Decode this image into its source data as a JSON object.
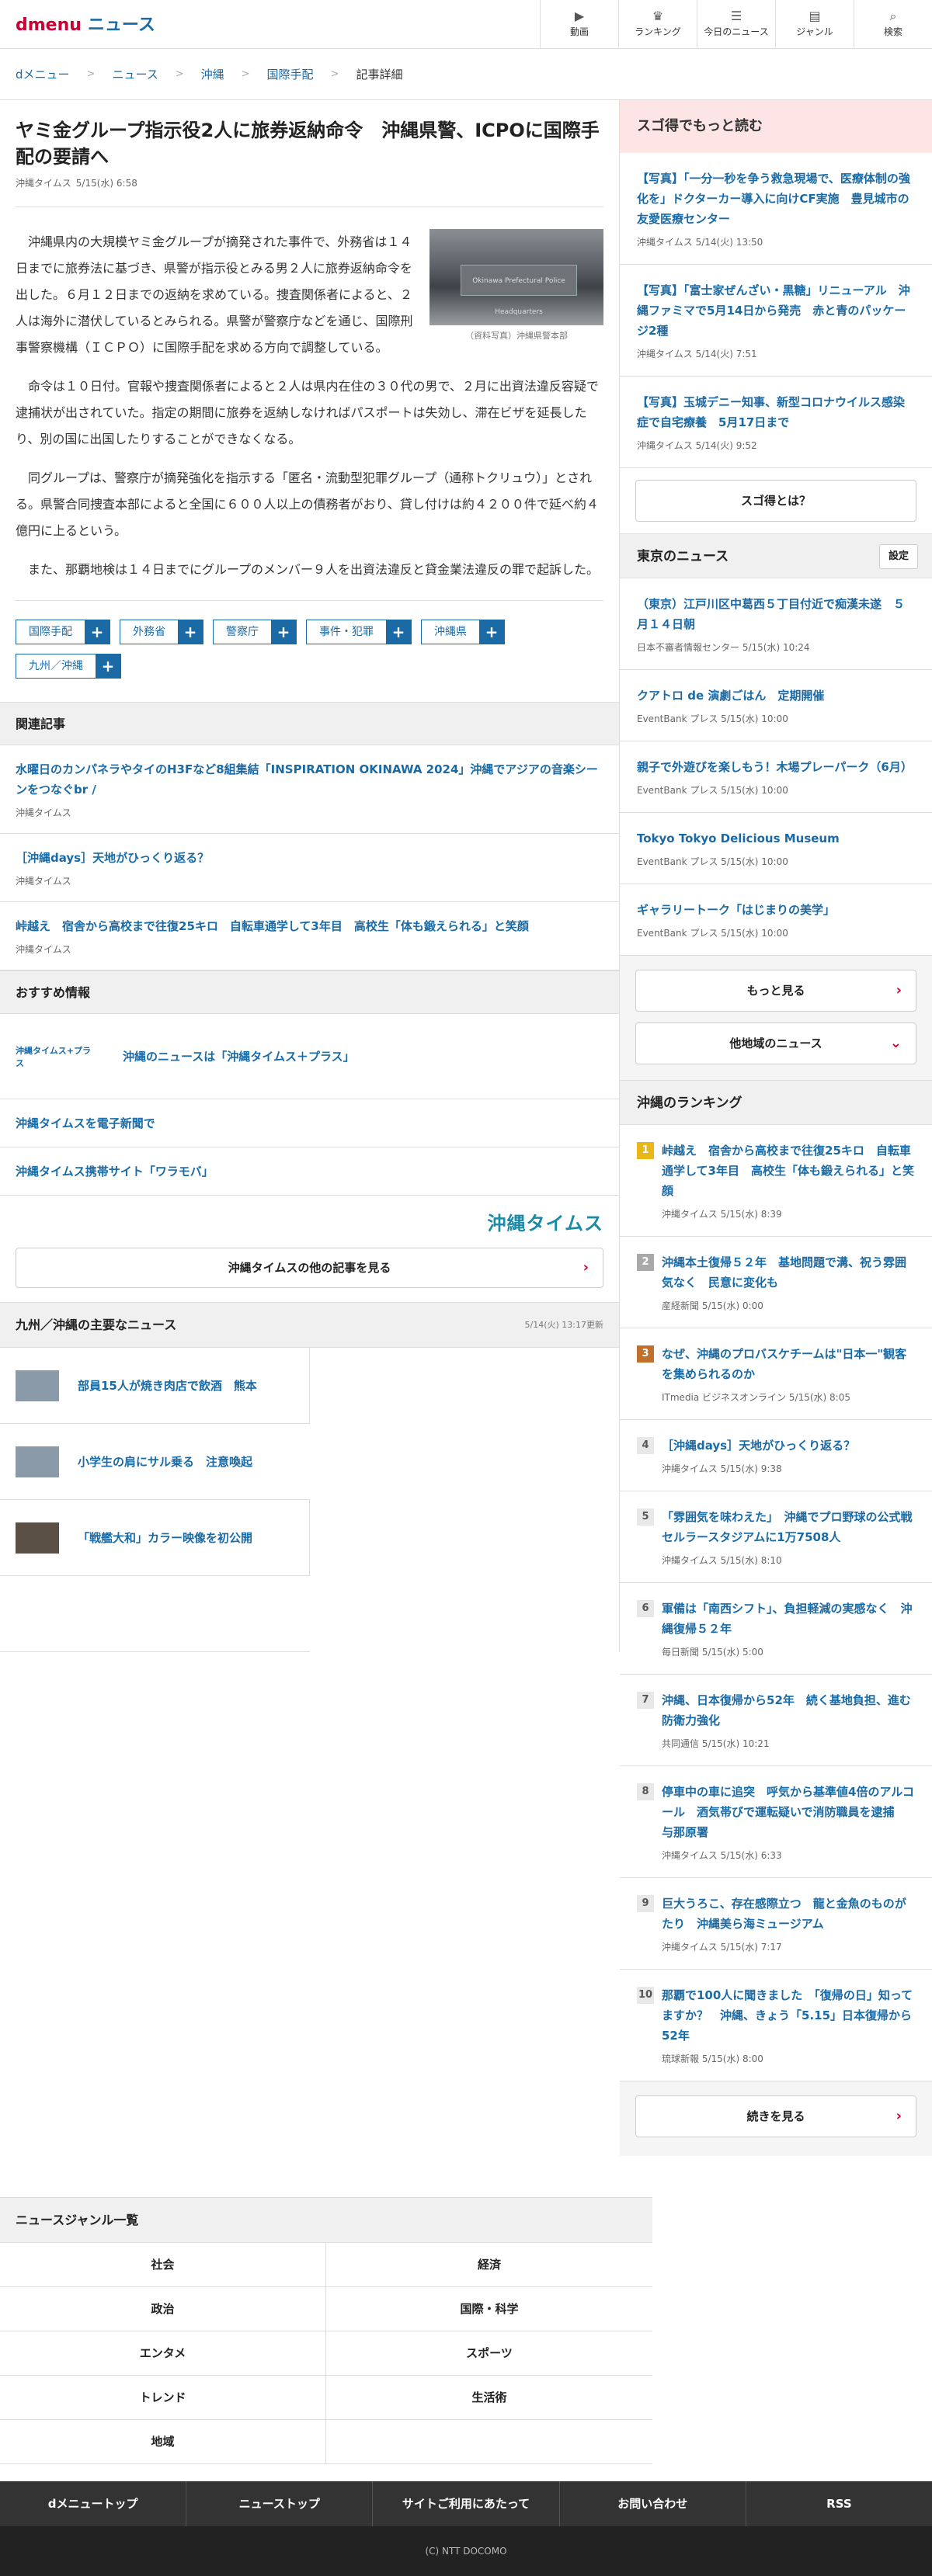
{
  "header": {
    "logo_d": "dmenu",
    "logo_news": "ニュース",
    "nav": [
      {
        "icon": "video-icon",
        "glyph": "▶",
        "label": "動画"
      },
      {
        "icon": "ranking-icon",
        "glyph": "♛",
        "label": "ランキング"
      },
      {
        "icon": "today-icon",
        "glyph": "☰",
        "label": "今日のニュース"
      },
      {
        "icon": "genre-icon",
        "glyph": "▤",
        "label": "ジャンル"
      },
      {
        "icon": "search-icon",
        "glyph": "⌕",
        "label": "検索"
      }
    ]
  },
  "breadcrumb": [
    "dメニュー",
    "ニュース",
    "沖縄",
    "国際手配",
    "記事詳細"
  ],
  "article": {
    "title": "ヤミ金グループ指示役2人に旅券返納命令　沖縄県警、ICPOに国際手配の要請へ",
    "source": "沖縄タイムス",
    "date": "5/15(水) 6:58",
    "photo_caption": "（資料写真）沖縄県警本部",
    "photo_sign": "Okinawa Prefectural Police Headquarters",
    "paragraphs": [
      "沖縄県内の大規模ヤミ金グループが摘発された事件で、外務省は１４日までに旅券法に基づき、県警が指示役とみる男２人に旅券返納命令を出した。６月１２日までの返納を求めている。捜査関係者によると、２人は海外に潜伏しているとみられる。県警が警察庁などを通じ、国際刑事警察機構（ＩＣＰＯ）に国際手配を求める方向で調整している。",
      "命令は１０日付。官報や捜査関係者によると２人は県内在住の３０代の男で、２月に出資法違反容疑で逮捕状が出されていた。指定の期間に旅券を返納しなければパスポートは失効し、滞在ビザを延長したり、別の国に出国したりすることができなくなる。",
      "同グループは、警察庁が摘発強化を指示する「匿名・流動型犯罪グループ（通称トクリュウ）」とされる。県警合同捜査本部によると全国に６００人以上の債務者がおり、貸し付けは約４２００件で延べ約４億円に上るという。",
      "また、那覇地検は１４日までにグループのメンバー９人を出資法違反と貸金業法違反の罪で起訴した。"
    ],
    "tags": [
      "国際手配",
      "外務省",
      "警察庁",
      "事件・犯罪",
      "沖縄県",
      "九州／沖縄"
    ]
  },
  "related": {
    "heading": "関連記事",
    "items": [
      {
        "title": "水曜日のカンパネラやタイのH3Fなど8組集結「INSPIRATION OKINAWA 2024」沖縄でアジアの音楽シーンをつなぐbr /",
        "source": "沖縄タイムス"
      },
      {
        "title": "［沖縄days］天地がひっくり返る？",
        "source": "沖縄タイムス"
      },
      {
        "title": "峠越え　宿舎から高校まで往復25キロ　自転車通学して3年目　高校生「体も鍛えられる」と笑顔",
        "source": "沖縄タイムス"
      }
    ]
  },
  "recommend": {
    "heading": "おすすめ情報",
    "logo_small": "沖縄タイムス+プラス",
    "items": [
      "沖縄のニュースは「沖縄タイムス＋プラス」",
      "沖縄タイムスを電子新聞で",
      "沖縄タイムス携帯サイト「ワラモバ」"
    ],
    "logo_big": "沖縄タイムス",
    "more_label": "沖縄タイムスの他の記事を見る"
  },
  "kyushu": {
    "heading": "九州／沖縄の主要なニュース",
    "updated": "5/14(火) 13:17更新",
    "items": [
      "部員15人が焼き肉店で飲酒　熊本",
      "小学生の肩にサル乗る　注意喚起",
      "「戦艦大和」カラー映像を初公開"
    ]
  },
  "sugotoku": {
    "heading": "スゴ得でもっと読む",
    "items": [
      {
        "title": "【写真】「一分一秒を争う救急現場で、医療体制の強化を」ドクターカー導入に向けCF実施　豊見城市の友愛医療センター",
        "source": "沖縄タイムス",
        "date": "5/14(火) 13:50"
      },
      {
        "title": "【写真】「富士家ぜんざい・黒糖」リニューアル　沖縄ファミマで5月14日から発売　赤と青のパッケージ2種",
        "source": "沖縄タイムス",
        "date": "5/14(火) 7:51"
      },
      {
        "title": "【写真】玉城デニー知事、新型コロナウイルス感染症で自宅療養　5月17日まで",
        "source": "沖縄タイムス",
        "date": "5/14(火) 9:52"
      }
    ],
    "what_label": "スゴ得とは？"
  },
  "tokyo": {
    "heading": "東京のニュース",
    "settings_label": "設定",
    "items": [
      {
        "title": "（東京）江戸川区中葛西５丁目付近で痴漢未遂　５月１４日朝",
        "source": "日本不審者情報センター",
        "date": "5/15(水) 10:24"
      },
      {
        "title": "クアトロ de 演劇ごはん　定期開催",
        "source": "EventBank プレス",
        "date": "5/15(水) 10:00"
      },
      {
        "title": "親子で外遊びを楽しもう！木場プレーパーク（6月）",
        "source": "EventBank プレス",
        "date": "5/15(水) 10:00"
      },
      {
        "title": "Tokyo Tokyo Delicious Museum",
        "source": "EventBank プレス",
        "date": "5/15(水) 10:00"
      },
      {
        "title": "ギャラリートーク「はじまりの美学」",
        "source": "EventBank プレス",
        "date": "5/15(水) 10:00"
      }
    ],
    "more_label": "もっと見る",
    "other_label": "他地域のニュース"
  },
  "ranking": {
    "heading": "沖縄のランキング",
    "items": [
      {
        "num": "1",
        "title": "峠越え　宿舎から高校まで往復25キロ　自転車通学して3年目　高校生「体も鍛えられる」と笑顔",
        "source": "沖縄タイムス",
        "date": "5/15(水) 8:39"
      },
      {
        "num": "2",
        "title": "沖縄本土復帰５２年　基地問題で溝、祝う雰囲気なく　民意に変化も",
        "source": "産経新聞",
        "date": "5/15(水) 0:00"
      },
      {
        "num": "3",
        "title": "なぜ、沖縄のプロバスケチームは\"日本一\"観客を集められるのか",
        "source": "ITmedia ビジネスオンライン",
        "date": "5/15(水) 8:05"
      },
      {
        "num": "4",
        "title": "［沖縄days］天地がひっくり返る？",
        "source": "沖縄タイムス",
        "date": "5/15(水) 9:38"
      },
      {
        "num": "5",
        "title": "「雰囲気を味わえた」　沖縄でプロ野球の公式戦　セルラースタジアムに1万7508人",
        "source": "沖縄タイムス",
        "date": "5/15(水) 8:10"
      },
      {
        "num": "6",
        "title": "軍備は「南西シフト」、負担軽減の実感なく　沖縄復帰５２年",
        "source": "毎日新聞",
        "date": "5/15(水) 5:00"
      },
      {
        "num": "7",
        "title": "沖縄、日本復帰から52年　続く基地負担、進む防衛力強化",
        "source": "共同通信",
        "date": "5/15(水) 10:21"
      },
      {
        "num": "8",
        "title": "停車中の車に追突　呼気から基準値4倍のアルコール　酒気帯びで運転疑いで消防職員を逮捕　与那原署",
        "source": "沖縄タイムス",
        "date": "5/15(水) 6:33"
      },
      {
        "num": "9",
        "title": "巨大うろこ、存在感際立つ　龍と金魚のものがたり　沖縄美ら海ミュージアム",
        "source": "沖縄タイムス",
        "date": "5/15(水) 7:17"
      },
      {
        "num": "10",
        "title": "那覇で100人に聞きました　「復帰の日」知ってますか？　沖縄、きょう「5.15」日本復帰から52年",
        "source": "琉球新報",
        "date": "5/15(水) 8:00"
      }
    ],
    "more_label": "続きを見る"
  },
  "genres": {
    "heading": "ニュースジャンル一覧",
    "items": [
      "社会",
      "経済",
      "政治",
      "国際・科学",
      "エンタメ",
      "スポーツ",
      "トレンド",
      "生活術",
      "地域"
    ]
  },
  "footer": {
    "links": [
      "dメニュートップ",
      "ニューストップ",
      "サイトご利用にあたって",
      "お問い合わせ",
      "RSS"
    ],
    "copyright": "(C) NTT DOCOMO"
  },
  "colors": {
    "brand_red": "#cc0033",
    "link_blue": "#1a6aa6",
    "sugotoku_bg": "#fde5e5"
  }
}
